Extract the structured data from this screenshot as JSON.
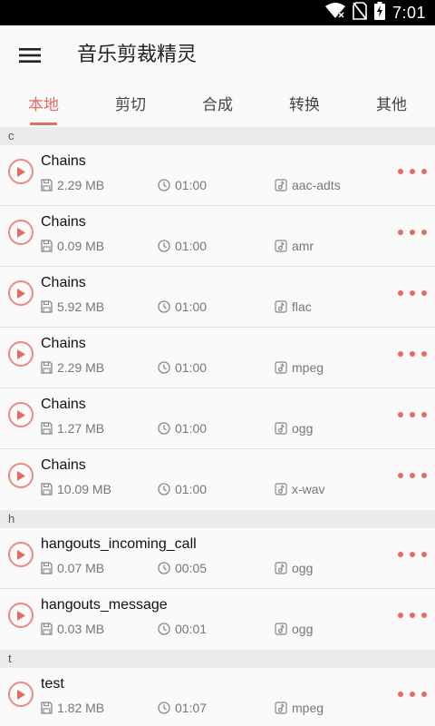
{
  "status_bar": {
    "time": "7:01",
    "icons": [
      "wifi-icon",
      "sim-no-signal-icon",
      "battery-charging-icon"
    ]
  },
  "app_bar": {
    "menu_icon": "hamburger-menu-icon",
    "title": "音乐剪裁精灵"
  },
  "tabs": [
    {
      "label": "本地",
      "active": true
    },
    {
      "label": "剪切",
      "active": false
    },
    {
      "label": "合成",
      "active": false
    },
    {
      "label": "转换",
      "active": false
    },
    {
      "label": "其他",
      "active": false
    }
  ],
  "sections": [
    {
      "header": "c",
      "items": [
        {
          "title": "Chains",
          "size": "2.29 MB",
          "duration": "01:00",
          "format": "aac-adts"
        },
        {
          "title": "Chains",
          "size": "0.09 MB",
          "duration": "01:00",
          "format": "amr"
        },
        {
          "title": "Chains",
          "size": "5.92 MB",
          "duration": "01:00",
          "format": "flac"
        },
        {
          "title": "Chains",
          "size": "2.29 MB",
          "duration": "01:00",
          "format": "mpeg"
        },
        {
          "title": "Chains",
          "size": "1.27 MB",
          "duration": "01:00",
          "format": "ogg"
        },
        {
          "title": "Chains",
          "size": "10.09 MB",
          "duration": "01:00",
          "format": "x-wav"
        }
      ]
    },
    {
      "header": "h",
      "items": [
        {
          "title": "hangouts_incoming_call",
          "size": "0.07 MB",
          "duration": "00:05",
          "format": "ogg"
        },
        {
          "title": "hangouts_message",
          "size": "0.03 MB",
          "duration": "00:01",
          "format": "ogg"
        }
      ]
    },
    {
      "header": "t",
      "items": [
        {
          "title": "test",
          "size": "1.82 MB",
          "duration": "01:07",
          "format": "mpeg"
        }
      ]
    }
  ],
  "colors": {
    "accent": "#e56b61",
    "play_ring": "#ea8a82",
    "section_bg": "#ebebeb",
    "text_primary": "#111111",
    "text_secondary": "#777777"
  }
}
